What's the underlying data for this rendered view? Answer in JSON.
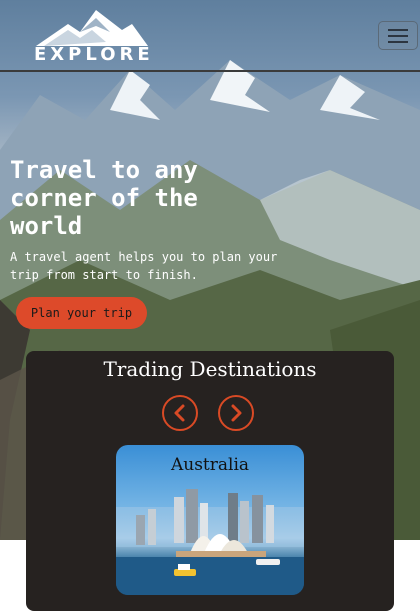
{
  "brand": {
    "logo_text": "EXPLORE",
    "logo_icon": "mountain-icon"
  },
  "nav": {
    "toggle_icon": "hamburger-icon"
  },
  "hero": {
    "title": "Travel to any corner of the world",
    "subtitle": "A travel agent helps you to plan your trip from start to finish.",
    "cta_label": "Plan your trip"
  },
  "destinations": {
    "title": "Trading Destinations",
    "prev_icon": "chevron-left-icon",
    "next_icon": "chevron-right-icon",
    "cards": [
      {
        "name": "Australia"
      }
    ]
  },
  "colors": {
    "accent": "#dd4a2a",
    "panel": "#262220",
    "text_light": "#ffffff"
  }
}
